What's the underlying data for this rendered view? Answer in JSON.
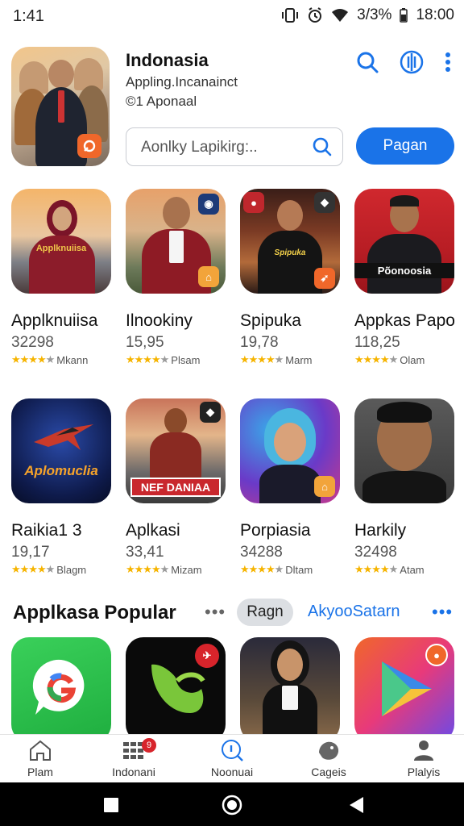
{
  "status_bar": {
    "time": "1:41",
    "battery": "3/3%",
    "clock": "18:00"
  },
  "header": {
    "title": "Indonasia",
    "subtitle": "Appling.Incanainct",
    "meta": "©1 Aponaal",
    "search_placeholder": "Aonlky Lapikirg:..",
    "primary_button": "Pagan"
  },
  "apps_row1": [
    {
      "name": "Applknuiisa",
      "number": "32298",
      "stars": 4,
      "label": "Mkann"
    },
    {
      "name": "Ilnookiny",
      "number": "15,95",
      "stars": 4,
      "label": "Plsam"
    },
    {
      "name": "Spipuka",
      "number": "19,78",
      "stars": 4,
      "label": "Marm"
    },
    {
      "name": "Appkas Papo",
      "number": "118,25",
      "stars": 4,
      "label": "Olam"
    }
  ],
  "apps_row2": [
    {
      "name": "Raikia1 3",
      "number": "19,17",
      "stars": 4,
      "label": "Blagm"
    },
    {
      "name": "Aplkasi",
      "number": "33,41",
      "stars": 4,
      "label": "Mizam"
    },
    {
      "name": "Porpiasia",
      "number": "34288",
      "stars": 4,
      "label": "Dltam"
    },
    {
      "name": "Harkily",
      "number": "32498",
      "stars": 4,
      "label": "Atam"
    }
  ],
  "icon_texts": {
    "applknuiisa": "Applknuiisa",
    "spipuka": "Spipuka",
    "appkas": "Põonoosia",
    "raikia": "Aplomuclia",
    "aplkasi": "NEF DANIAA"
  },
  "section": {
    "title": "Applkasa Popular",
    "chip": "Ragn",
    "link": "AkyooSatarn"
  },
  "tabs": [
    {
      "label": "Plam"
    },
    {
      "label": "Indonani",
      "badge": "9"
    },
    {
      "label": "Noonuai"
    },
    {
      "label": "Cageis"
    },
    {
      "label": "Plalyis"
    }
  ],
  "colors": {
    "accent": "#1a73e8",
    "star": "#f6b400",
    "badge": "#f0672a"
  }
}
